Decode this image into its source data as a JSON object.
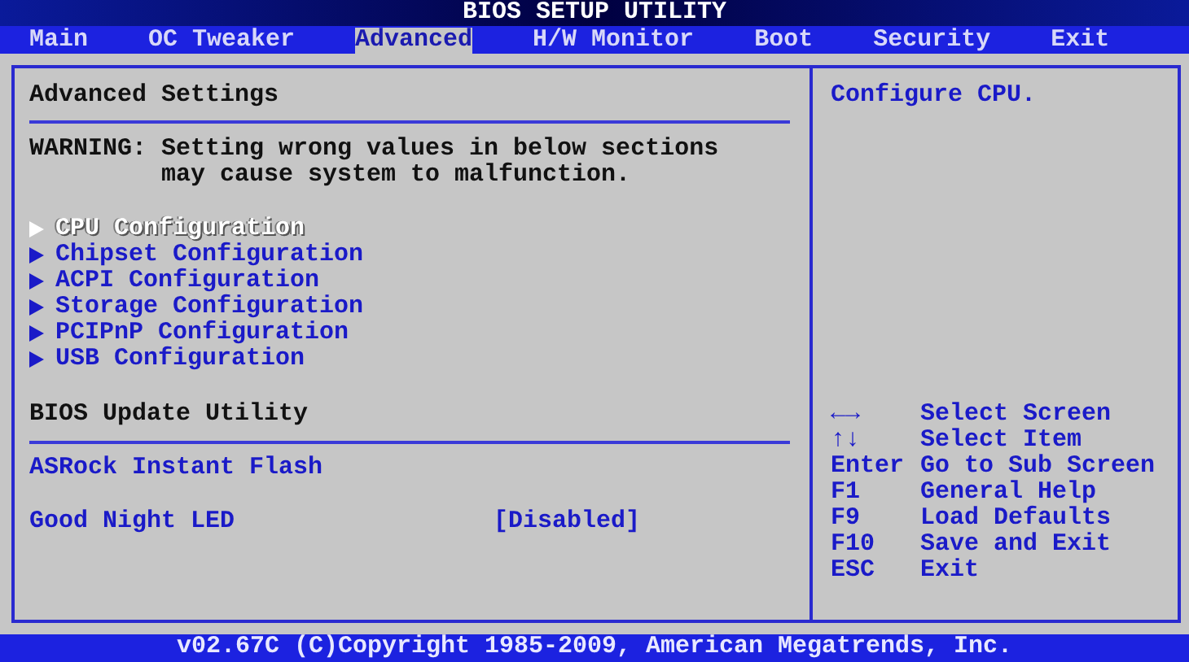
{
  "window": {
    "title": "BIOS SETUP UTILITY"
  },
  "tabs": [
    {
      "label": "Main",
      "selected": false
    },
    {
      "label": "OC Tweaker",
      "selected": false
    },
    {
      "label": "Advanced",
      "selected": true
    },
    {
      "label": "H/W Monitor",
      "selected": false
    },
    {
      "label": "Boot",
      "selected": false
    },
    {
      "label": "Security",
      "selected": false
    },
    {
      "label": "Exit",
      "selected": false
    }
  ],
  "panel": {
    "title": "Advanced Settings",
    "warning": {
      "label": "WARNING:",
      "message": "Setting wrong values in below sections may cause system to malfunction."
    },
    "submenus": [
      {
        "label": "CPU Configuration",
        "selected": true
      },
      {
        "label": "Chipset Configuration",
        "selected": false
      },
      {
        "label": "ACPI Configuration",
        "selected": false
      },
      {
        "label": "Storage Configuration",
        "selected": false
      },
      {
        "label": "PCIPnP Configuration",
        "selected": false
      },
      {
        "label": "USB Configuration",
        "selected": false
      }
    ],
    "section": {
      "title": "BIOS Update Utility",
      "items": [
        {
          "kind": "action",
          "label": "ASRock Instant Flash"
        },
        {
          "kind": "setting",
          "label": "Good Night LED",
          "value": "[Disabled]"
        }
      ]
    }
  },
  "help": {
    "text": "Configure CPU.",
    "keys": [
      {
        "key": "←→",
        "action": "Select Screen"
      },
      {
        "key": "↑↓",
        "action": "Select Item"
      },
      {
        "key": "Enter",
        "action": "Go to Sub Screen"
      },
      {
        "key": "F1",
        "action": "General Help"
      },
      {
        "key": "F9",
        "action": "Load Defaults"
      },
      {
        "key": "F10",
        "action": "Save and Exit"
      },
      {
        "key": "ESC",
        "action": "Exit"
      }
    ]
  },
  "footer": "v02.67C (C)Copyright 1985-2009, American Megatrends, Inc."
}
